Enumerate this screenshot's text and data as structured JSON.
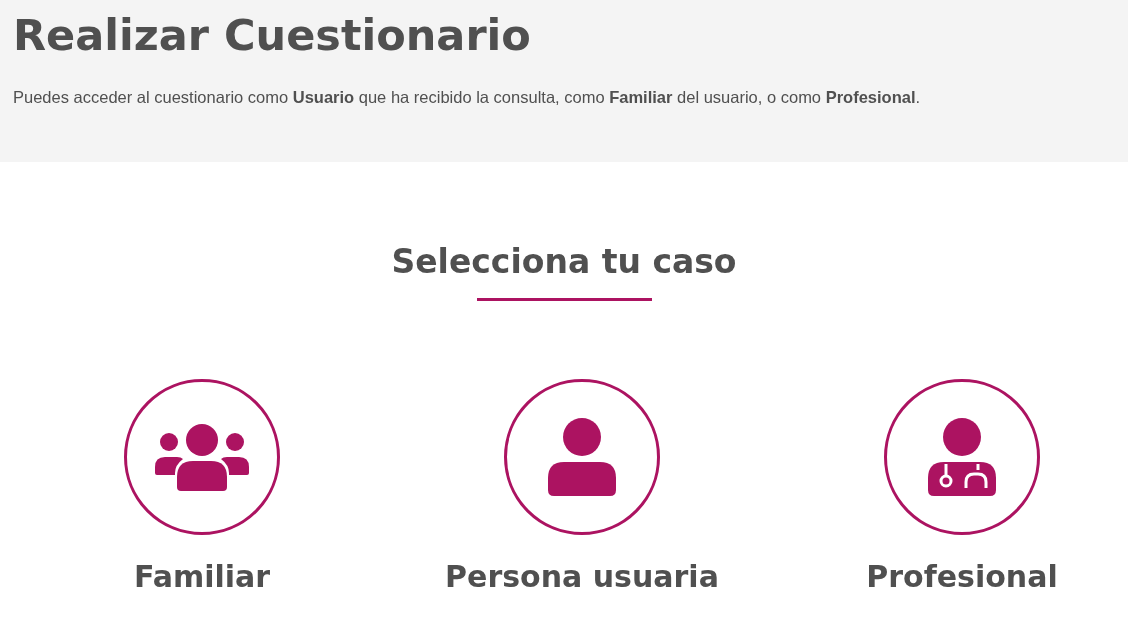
{
  "header": {
    "title": "Realizar Cuestionario",
    "intro": "Puedes acceder al cuestionario como **Usuario** que ha recibido la consulta, como **Familiar** del usuario, o como **Profesional**."
  },
  "section": {
    "heading": "Selecciona tu caso"
  },
  "options": [
    {
      "kind": "group",
      "label": "Familiar"
    },
    {
      "kind": "user",
      "label": "Persona usuaria"
    },
    {
      "kind": "doctor",
      "label": "Profesional"
    }
  ]
}
